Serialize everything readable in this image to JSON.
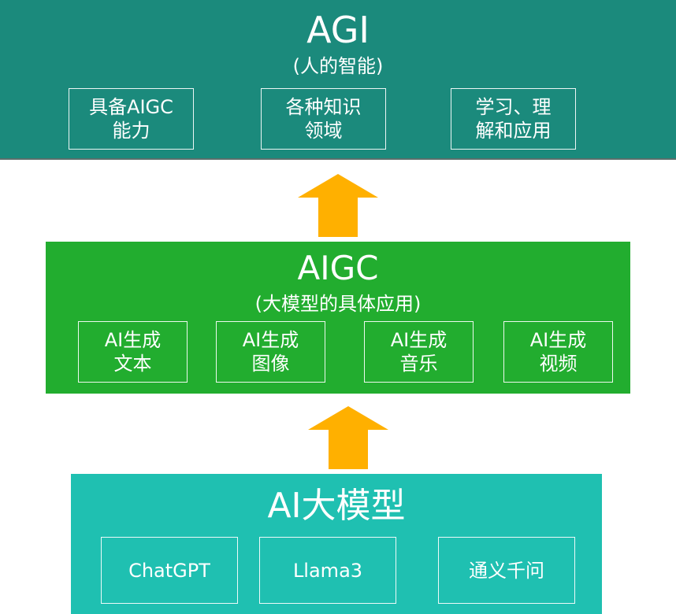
{
  "colors": {
    "agi_panel": "#1b8a7c",
    "aigc_panel": "#22ad2f",
    "model_panel": "#1fc0b1",
    "arrow": "#ffb000",
    "text": "#ffffff"
  },
  "top_layer": {
    "title": "AGI",
    "subtitle": "(人的智能)",
    "boxes": [
      "具备AIGC\n能力",
      "各种知识\n领域",
      "学习、理\n解和应用"
    ]
  },
  "middle_layer": {
    "title": "AIGC",
    "subtitle": "(大模型的具体应用)",
    "boxes": [
      "AI生成\n文本",
      "AI生成\n图像",
      "AI生成\n音乐",
      "AI生成\n视频"
    ]
  },
  "bottom_layer": {
    "title": "AI大模型",
    "boxes": [
      "ChatGPT",
      "Llama3",
      "通义千问"
    ]
  },
  "icons": {
    "arrow_upper": "arrow-up-icon",
    "arrow_lower": "arrow-up-icon"
  }
}
